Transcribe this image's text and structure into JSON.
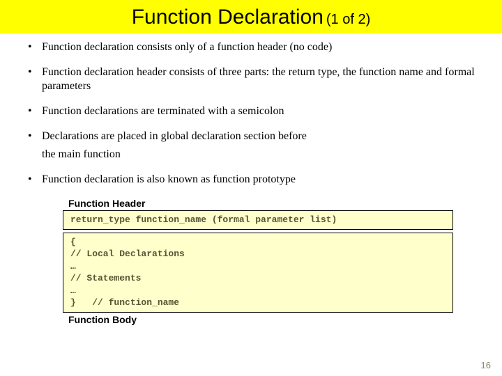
{
  "title": {
    "main": "Function Declaration",
    "sub": "(1 of 2)"
  },
  "bullets": [
    "Function declaration consists only of a function header (no code)",
    "Function declaration header consists of three parts: the return type, the function name and formal parameters",
    "Function declarations are terminated with a semicolon",
    "Declarations are placed in global declaration section before"
  ],
  "continuation": "the main function",
  "bullets2": [
    "Function declaration is also known as function prototype"
  ],
  "diagram": {
    "header_label": "Function Header",
    "header_code": "return_type function_name (formal parameter list)",
    "body_lines": [
      "{",
      "// Local Declarations",
      "…",
      "// Statements",
      "…",
      "}   // function_name"
    ],
    "body_label": "Function Body"
  },
  "page_number": "16"
}
